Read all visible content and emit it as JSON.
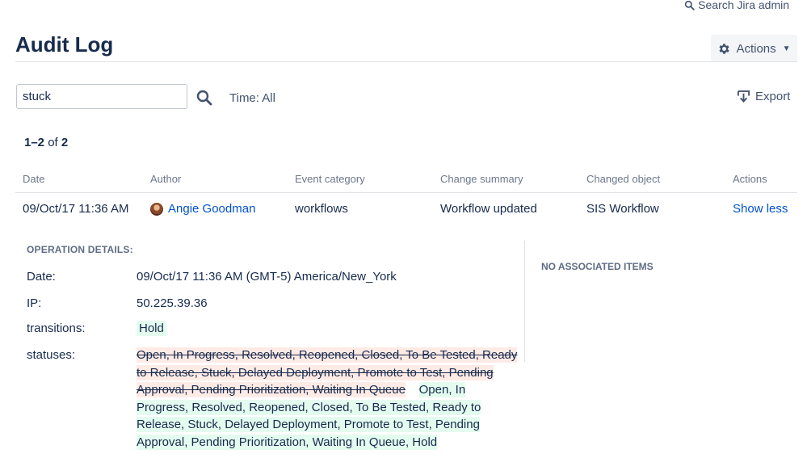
{
  "top": {
    "search_link": "Search Jira admin"
  },
  "header": {
    "title": "Audit Log",
    "actions_label": "Actions"
  },
  "filter": {
    "search_value": "stuck",
    "time_label": "Time: All",
    "export_label": "Export"
  },
  "results": {
    "range": "1–2",
    "of_label": "of",
    "total": "2"
  },
  "table": {
    "columns": [
      "Date",
      "Author",
      "Event category",
      "Change summary",
      "Changed object",
      "Actions"
    ],
    "rows": [
      {
        "date": "09/Oct/17 11:36 AM",
        "author": "Angie Goodman",
        "category": "workflows",
        "summary": "Workflow updated",
        "object": "SIS Workflow",
        "action": "Show less"
      }
    ]
  },
  "details": {
    "heading": "OPERATION DETAILS:",
    "date_label": "Date:",
    "date_value": "09/Oct/17 11:36 AM (GMT-5) America/New_York",
    "ip_label": "IP:",
    "ip_value": "50.225.39.36",
    "transitions_label": "transitions:",
    "transitions_value": "Hold",
    "statuses_label": "statuses:",
    "statuses_old": "Open, In Progress, Resolved, Reopened, Closed, To Be Tested, Ready to Release, Stuck, Delayed Deployment, Promote to Test, Pending Approval, Pending Prioritization, Waiting In Queue",
    "statuses_new": "Open, In Progress, Resolved, Reopened, Closed, To Be Tested, Ready to Release, Stuck, Delayed Deployment, Promote to Test, Pending Approval, Pending Prioritization, Waiting In Queue, Hold",
    "no_associated": "NO ASSOCIATED ITEMS"
  },
  "colors": {
    "text": "#172b4d",
    "link": "#0052cc",
    "muted": "#6b778c",
    "diff_added_bg": "#e3fcef",
    "diff_removed_bg": "#ffebe6"
  }
}
